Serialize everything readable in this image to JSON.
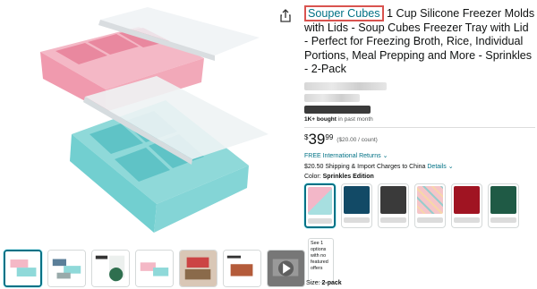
{
  "product": {
    "brand": "Souper Cubes",
    "title_rest": " 1 Cup Silicone Freezer Molds with Lids - Soup Cubes Freezer Tray with Lid - Perfect for Freezing Broth, Rice, Individual Portions, Meal Prepping and More - Sprinkles - 2-Pack",
    "bought_bold": "1K+ bought",
    "bought_rest": " in past month",
    "price_currency": "$",
    "price_whole": "39",
    "price_fraction": "99",
    "price_unit": "($20.00 / count)",
    "returns": "FREE International Returns",
    "shipping_prefix": "$20.50 Shipping & Import Charges to China",
    "shipping_link": "Details",
    "color_label": "Color: ",
    "color_value": "Sprinkles Edition",
    "see_options": "See 1 options with no featured offers",
    "size_label": "Size: ",
    "size_value": "2-pack"
  },
  "swatches": [
    {
      "name": "sprinkles",
      "color": "#f3b7c8",
      "selected": true
    },
    {
      "name": "navy",
      "color": "#124a66"
    },
    {
      "name": "charcoal",
      "color": "#3a3a3a"
    },
    {
      "name": "sprinkles-pink",
      "color": "#f5c5c8"
    },
    {
      "name": "red",
      "color": "#a01422"
    },
    {
      "name": "green",
      "color": "#1f5a45"
    }
  ],
  "thumbnails": [
    "thumb-1",
    "thumb-2",
    "thumb-3",
    "thumb-4",
    "thumb-5",
    "thumb-6",
    "thumb-7-video"
  ],
  "icons": {
    "share": "share-icon",
    "play": "play-icon",
    "chevron": "chevron-down-icon"
  }
}
